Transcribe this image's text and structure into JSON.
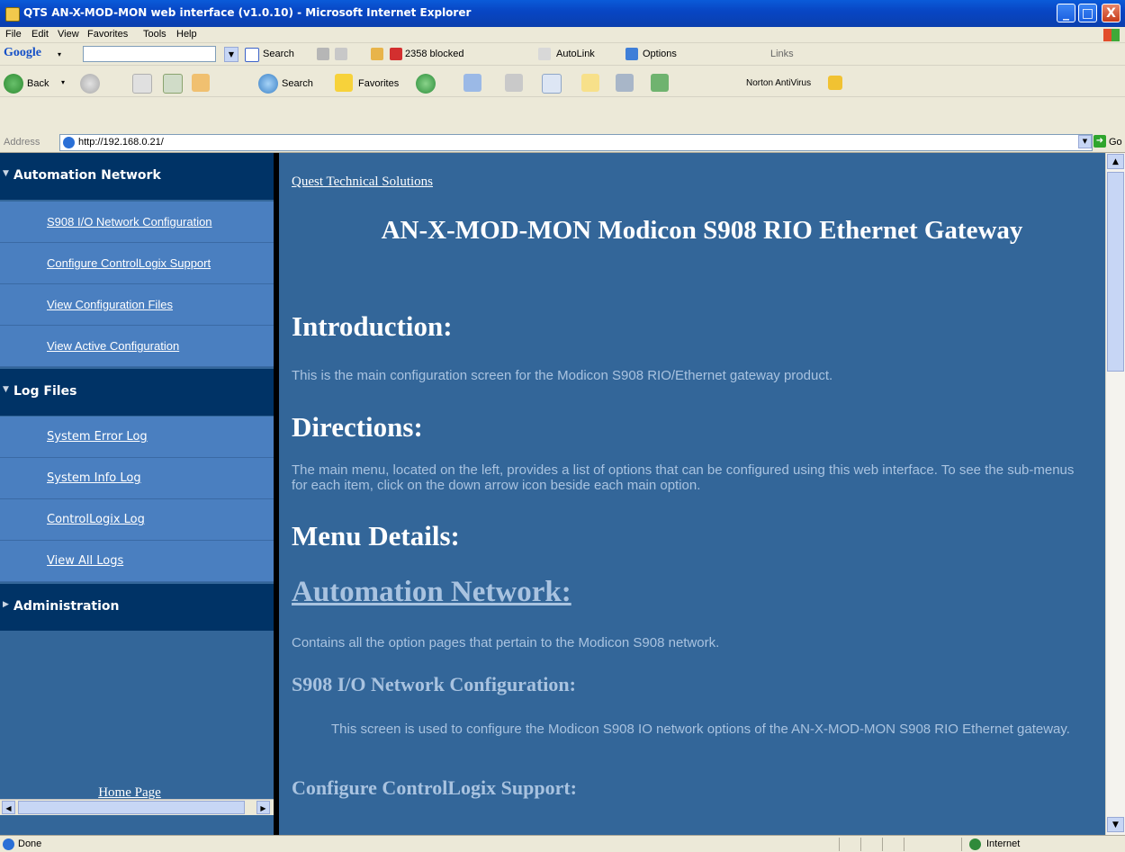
{
  "window": {
    "title": "QTS AN-X-MOD-MON web interface (v1.0.10) - Microsoft Internet Explorer",
    "controls": {
      "minimize": "_",
      "maximize": "□",
      "close": "X"
    }
  },
  "menubar": {
    "items": [
      "File",
      "Edit",
      "View",
      "Favorites",
      "Tools",
      "Help"
    ]
  },
  "google_toolbar": {
    "logo": "Google",
    "search_value": "",
    "search_label": "Search",
    "blocked": "2358 blocked",
    "autolink": "AutoLink",
    "options": "Options",
    "links": "Links"
  },
  "std_toolbar": {
    "back": "Back",
    "search": "Search",
    "favorites": "Favorites",
    "norton": "Norton AntiVirus"
  },
  "address": {
    "label": "Address",
    "url": "http://192.168.0.21/",
    "go": "Go"
  },
  "left_nav": {
    "sections": [
      {
        "label": "Automation Network",
        "expanded": true,
        "items": [
          "S908 I/O Network Configuration",
          "Configure ControlLogix Support",
          "View Configuration Files",
          "View Active Configuration"
        ]
      },
      {
        "label": "Log Files",
        "expanded": true,
        "items": [
          "System Error Log",
          "System Info Log",
          "ControlLogix Log",
          "View All Logs"
        ]
      },
      {
        "label": "Administration",
        "expanded": false,
        "items": []
      }
    ],
    "home_link": "Home Page"
  },
  "content": {
    "company_link": "Quest Technical Solutions",
    "title": "AN-X-MOD-MON Modicon S908 RIO Ethernet Gateway",
    "intro_heading": "Introduction:",
    "intro_text": "This is the main configuration screen for the Modicon S908 RIO/Ethernet gateway product.",
    "directions_heading": "Directions:",
    "directions_text": "The main menu, located on the left, provides a list of options that can be configured using this web interface. To see the sub-menus for each item, click on the down arrow icon beside each main option.",
    "menu_details_heading": "Menu Details:",
    "automation_link": "Automation Network:",
    "automation_text": "Contains all the option pages that pertain to the Modicon S908 network.",
    "s908_heading": "S908 I/O Network Configuration:",
    "s908_text": "This screen is used to configure the Modicon S908 IO network options of the AN-X-MOD-MON S908 RIO Ethernet gateway.",
    "clx_heading": "Configure ControlLogix Support:"
  },
  "status_bar": {
    "text": "Done",
    "zone": "Internet"
  }
}
